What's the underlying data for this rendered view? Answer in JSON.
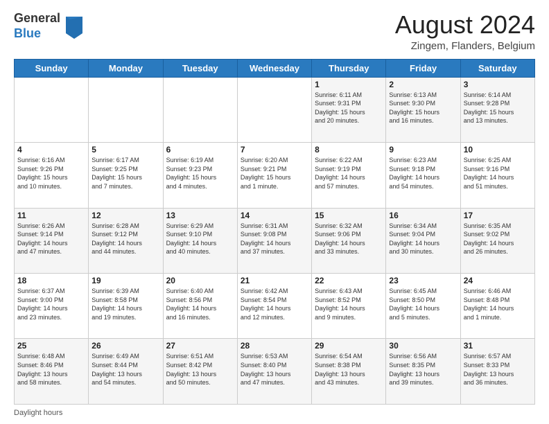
{
  "header": {
    "logo_general": "General",
    "logo_blue": "Blue",
    "month_title": "August 2024",
    "location": "Zingem, Flanders, Belgium"
  },
  "days_of_week": [
    "Sunday",
    "Monday",
    "Tuesday",
    "Wednesday",
    "Thursday",
    "Friday",
    "Saturday"
  ],
  "footer": {
    "daylight_label": "Daylight hours"
  },
  "weeks": [
    [
      {
        "num": "",
        "info": ""
      },
      {
        "num": "",
        "info": ""
      },
      {
        "num": "",
        "info": ""
      },
      {
        "num": "",
        "info": ""
      },
      {
        "num": "1",
        "info": "Sunrise: 6:11 AM\nSunset: 9:31 PM\nDaylight: 15 hours\nand 20 minutes."
      },
      {
        "num": "2",
        "info": "Sunrise: 6:13 AM\nSunset: 9:30 PM\nDaylight: 15 hours\nand 16 minutes."
      },
      {
        "num": "3",
        "info": "Sunrise: 6:14 AM\nSunset: 9:28 PM\nDaylight: 15 hours\nand 13 minutes."
      }
    ],
    [
      {
        "num": "4",
        "info": "Sunrise: 6:16 AM\nSunset: 9:26 PM\nDaylight: 15 hours\nand 10 minutes."
      },
      {
        "num": "5",
        "info": "Sunrise: 6:17 AM\nSunset: 9:25 PM\nDaylight: 15 hours\nand 7 minutes."
      },
      {
        "num": "6",
        "info": "Sunrise: 6:19 AM\nSunset: 9:23 PM\nDaylight: 15 hours\nand 4 minutes."
      },
      {
        "num": "7",
        "info": "Sunrise: 6:20 AM\nSunset: 9:21 PM\nDaylight: 15 hours\nand 1 minute."
      },
      {
        "num": "8",
        "info": "Sunrise: 6:22 AM\nSunset: 9:19 PM\nDaylight: 14 hours\nand 57 minutes."
      },
      {
        "num": "9",
        "info": "Sunrise: 6:23 AM\nSunset: 9:18 PM\nDaylight: 14 hours\nand 54 minutes."
      },
      {
        "num": "10",
        "info": "Sunrise: 6:25 AM\nSunset: 9:16 PM\nDaylight: 14 hours\nand 51 minutes."
      }
    ],
    [
      {
        "num": "11",
        "info": "Sunrise: 6:26 AM\nSunset: 9:14 PM\nDaylight: 14 hours\nand 47 minutes."
      },
      {
        "num": "12",
        "info": "Sunrise: 6:28 AM\nSunset: 9:12 PM\nDaylight: 14 hours\nand 44 minutes."
      },
      {
        "num": "13",
        "info": "Sunrise: 6:29 AM\nSunset: 9:10 PM\nDaylight: 14 hours\nand 40 minutes."
      },
      {
        "num": "14",
        "info": "Sunrise: 6:31 AM\nSunset: 9:08 PM\nDaylight: 14 hours\nand 37 minutes."
      },
      {
        "num": "15",
        "info": "Sunrise: 6:32 AM\nSunset: 9:06 PM\nDaylight: 14 hours\nand 33 minutes."
      },
      {
        "num": "16",
        "info": "Sunrise: 6:34 AM\nSunset: 9:04 PM\nDaylight: 14 hours\nand 30 minutes."
      },
      {
        "num": "17",
        "info": "Sunrise: 6:35 AM\nSunset: 9:02 PM\nDaylight: 14 hours\nand 26 minutes."
      }
    ],
    [
      {
        "num": "18",
        "info": "Sunrise: 6:37 AM\nSunset: 9:00 PM\nDaylight: 14 hours\nand 23 minutes."
      },
      {
        "num": "19",
        "info": "Sunrise: 6:39 AM\nSunset: 8:58 PM\nDaylight: 14 hours\nand 19 minutes."
      },
      {
        "num": "20",
        "info": "Sunrise: 6:40 AM\nSunset: 8:56 PM\nDaylight: 14 hours\nand 16 minutes."
      },
      {
        "num": "21",
        "info": "Sunrise: 6:42 AM\nSunset: 8:54 PM\nDaylight: 14 hours\nand 12 minutes."
      },
      {
        "num": "22",
        "info": "Sunrise: 6:43 AM\nSunset: 8:52 PM\nDaylight: 14 hours\nand 9 minutes."
      },
      {
        "num": "23",
        "info": "Sunrise: 6:45 AM\nSunset: 8:50 PM\nDaylight: 14 hours\nand 5 minutes."
      },
      {
        "num": "24",
        "info": "Sunrise: 6:46 AM\nSunset: 8:48 PM\nDaylight: 14 hours\nand 1 minute."
      }
    ],
    [
      {
        "num": "25",
        "info": "Sunrise: 6:48 AM\nSunset: 8:46 PM\nDaylight: 13 hours\nand 58 minutes."
      },
      {
        "num": "26",
        "info": "Sunrise: 6:49 AM\nSunset: 8:44 PM\nDaylight: 13 hours\nand 54 minutes."
      },
      {
        "num": "27",
        "info": "Sunrise: 6:51 AM\nSunset: 8:42 PM\nDaylight: 13 hours\nand 50 minutes."
      },
      {
        "num": "28",
        "info": "Sunrise: 6:53 AM\nSunset: 8:40 PM\nDaylight: 13 hours\nand 47 minutes."
      },
      {
        "num": "29",
        "info": "Sunrise: 6:54 AM\nSunset: 8:38 PM\nDaylight: 13 hours\nand 43 minutes."
      },
      {
        "num": "30",
        "info": "Sunrise: 6:56 AM\nSunset: 8:35 PM\nDaylight: 13 hours\nand 39 minutes."
      },
      {
        "num": "31",
        "info": "Sunrise: 6:57 AM\nSunset: 8:33 PM\nDaylight: 13 hours\nand 36 minutes."
      }
    ]
  ]
}
